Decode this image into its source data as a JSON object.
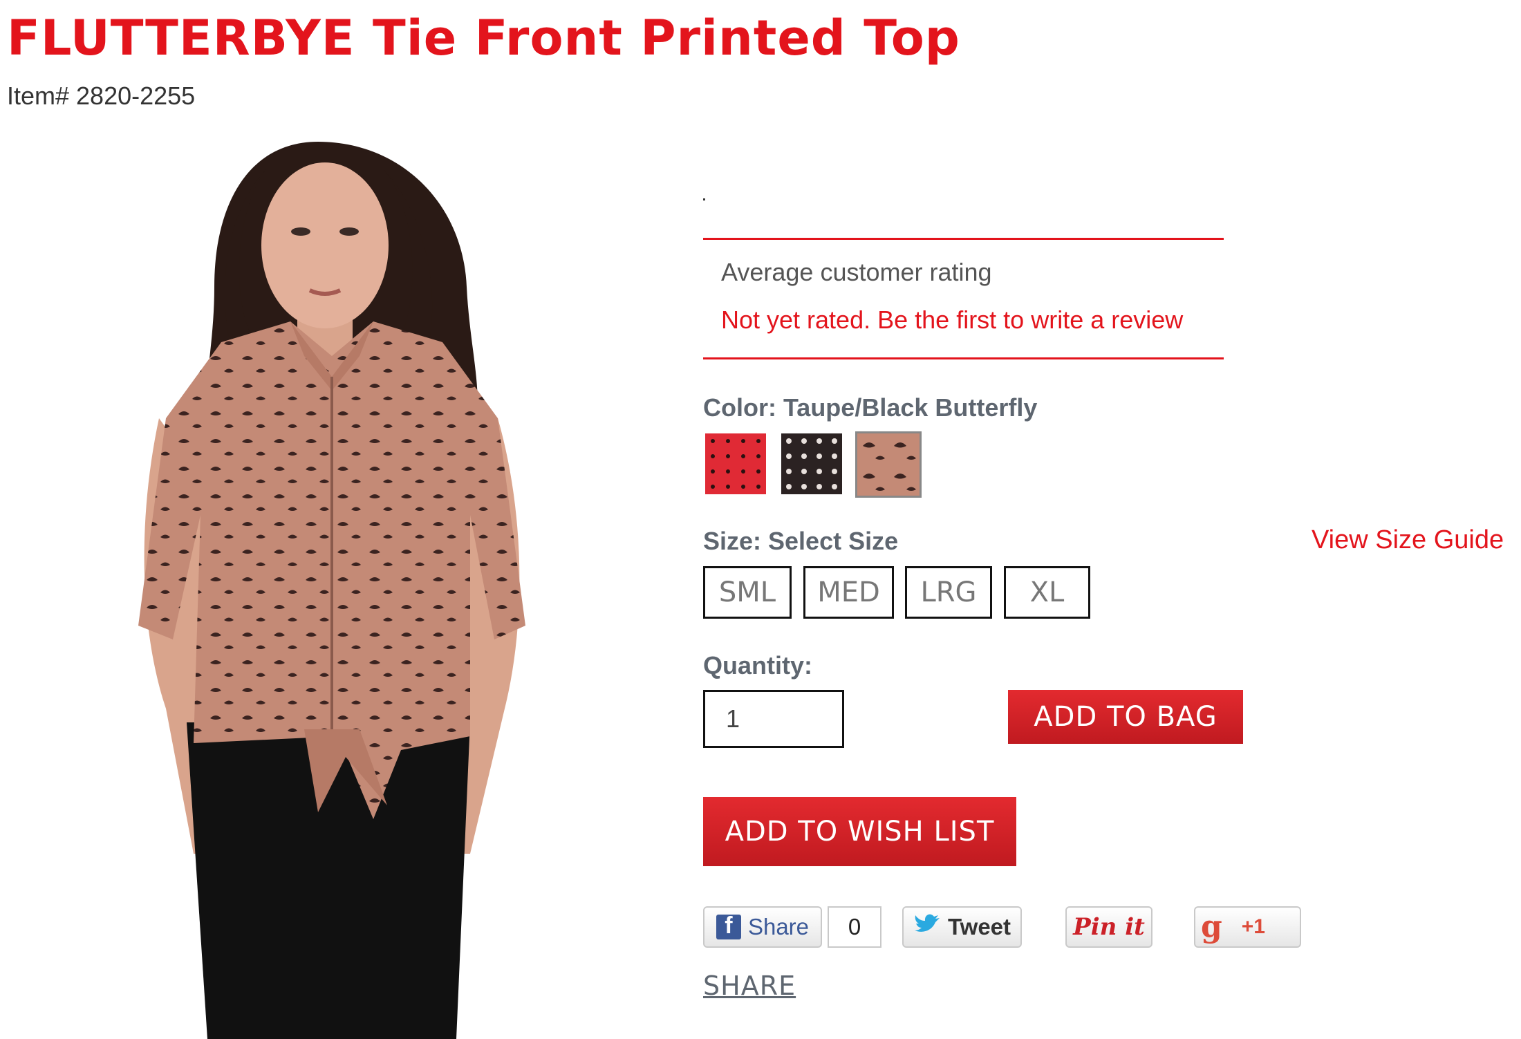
{
  "product": {
    "title": "FLUTTERBYE Tie Front Printed Top",
    "item_number": "Item# 2820-2255"
  },
  "rating": {
    "heading": "Average customer rating",
    "status": "Not yet rated. Be the first to write a review"
  },
  "color": {
    "label": "Color: Taupe/Black Butterfly",
    "swatches": [
      {
        "name": "red-polka",
        "hex": "#e02a35"
      },
      {
        "name": "black-polka",
        "hex": "#2b2222"
      },
      {
        "name": "taupe-butterfly",
        "hex": "#c48a76",
        "selected": true
      }
    ]
  },
  "size": {
    "label": "Size: Select Size",
    "guide": "View Size Guide",
    "options": [
      "SML",
      "MED",
      "LRG",
      "XL"
    ]
  },
  "quantity": {
    "label": "Quantity:",
    "value": "1"
  },
  "buttons": {
    "add_to_bag": "ADD TO BAG",
    "add_to_wish_list": "ADD TO WISH LIST"
  },
  "social": {
    "facebook_share": "Share",
    "facebook_count": "0",
    "tweet": "Tweet",
    "pinit": "Pin it",
    "gplus": "+1",
    "share_link": "SHARE"
  },
  "colors": {
    "accent": "#e3141c",
    "label_gray": "#5e6670"
  }
}
